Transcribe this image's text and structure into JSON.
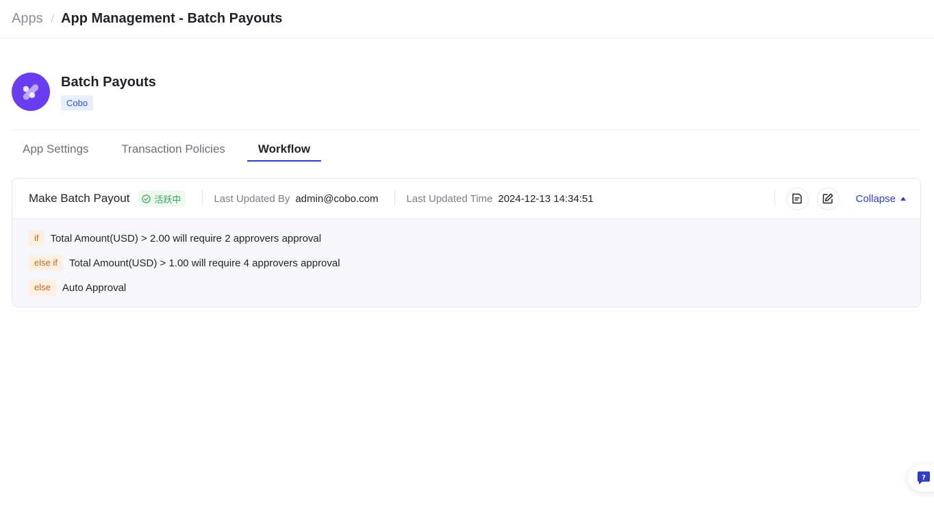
{
  "breadcrumb": {
    "root": "Apps",
    "separator": "/",
    "current": "App Management - Batch Payouts"
  },
  "app": {
    "name": "Batch Payouts",
    "tag": "Cobo",
    "logo_icon": "batch-payouts-logo",
    "logo_color": "#6a3ef0"
  },
  "tabs": [
    {
      "label": "App Settings",
      "active": false
    },
    {
      "label": "Transaction Policies",
      "active": false
    },
    {
      "label": "Workflow",
      "active": true
    }
  ],
  "workflow": {
    "name": "Make Batch Payout",
    "status": "活跃中",
    "status_color": "#3aa55a",
    "updated_by_label": "Last Updated By",
    "updated_by": "admin@cobo.com",
    "updated_time_label": "Last Updated Time",
    "updated_time": "2024-12-13 14:34:51",
    "view_icon": "document-icon",
    "edit_icon": "edit-icon",
    "collapse_label": "Collapse",
    "rules": [
      {
        "keyword": "if",
        "text": "Total Amount(USD) > 2.00 will require 2 approvers approval"
      },
      {
        "keyword": "else if",
        "text": "Total Amount(USD) > 1.00 will require 4 approvers approval"
      },
      {
        "keyword": "else",
        "text": "Auto Approval"
      }
    ]
  },
  "help": {
    "icon": "help-chat-icon"
  },
  "colors": {
    "accent": "#2d3ec8",
    "keyword_bg": "#fdf0e2",
    "keyword_text": "#c2681a"
  }
}
